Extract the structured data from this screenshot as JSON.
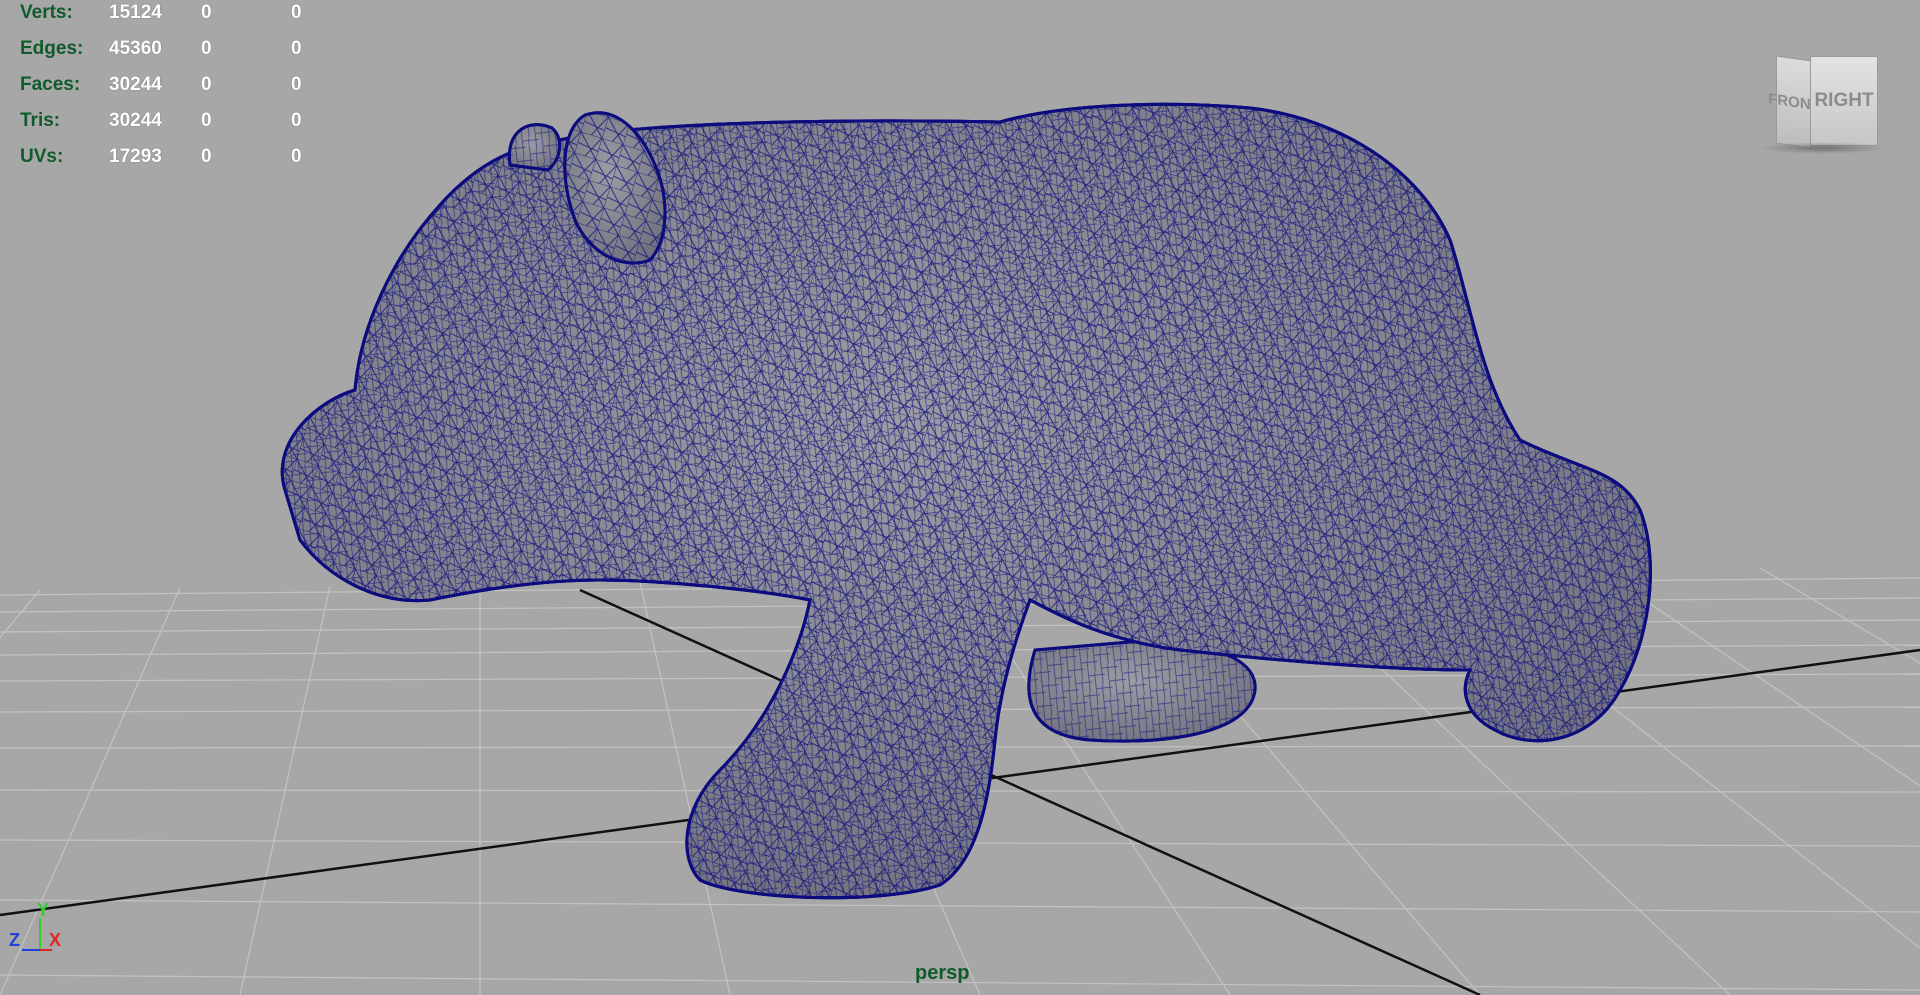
{
  "hud": {
    "rows": [
      {
        "label": "Verts:",
        "values": [
          "15124",
          "0",
          "0"
        ]
      },
      {
        "label": "Edges:",
        "values": [
          "45360",
          "0",
          "0"
        ]
      },
      {
        "label": "Faces:",
        "values": [
          "30244",
          "0",
          "0"
        ]
      },
      {
        "label": "Tris:",
        "values": [
          "30244",
          "0",
          "0"
        ]
      },
      {
        "label": "UVs:",
        "values": [
          "17293",
          "0",
          "0"
        ]
      }
    ]
  },
  "viewcube": {
    "front_label": "FRONT",
    "right_label": "RIGHT"
  },
  "axis": {
    "y": "Y",
    "z": "Z",
    "x": "X"
  },
  "camera": {
    "name": "persp"
  },
  "colors": {
    "background": "#a7a7a7",
    "grid": "#c3c3c3",
    "grid_axis": "#111111",
    "wireframe": "#0c0c7e",
    "model_fill": "#8e8e95",
    "hud_label": "#0f5b2c"
  },
  "model": {
    "name": "bear-mesh",
    "display": "wireframe-on-shaded"
  }
}
